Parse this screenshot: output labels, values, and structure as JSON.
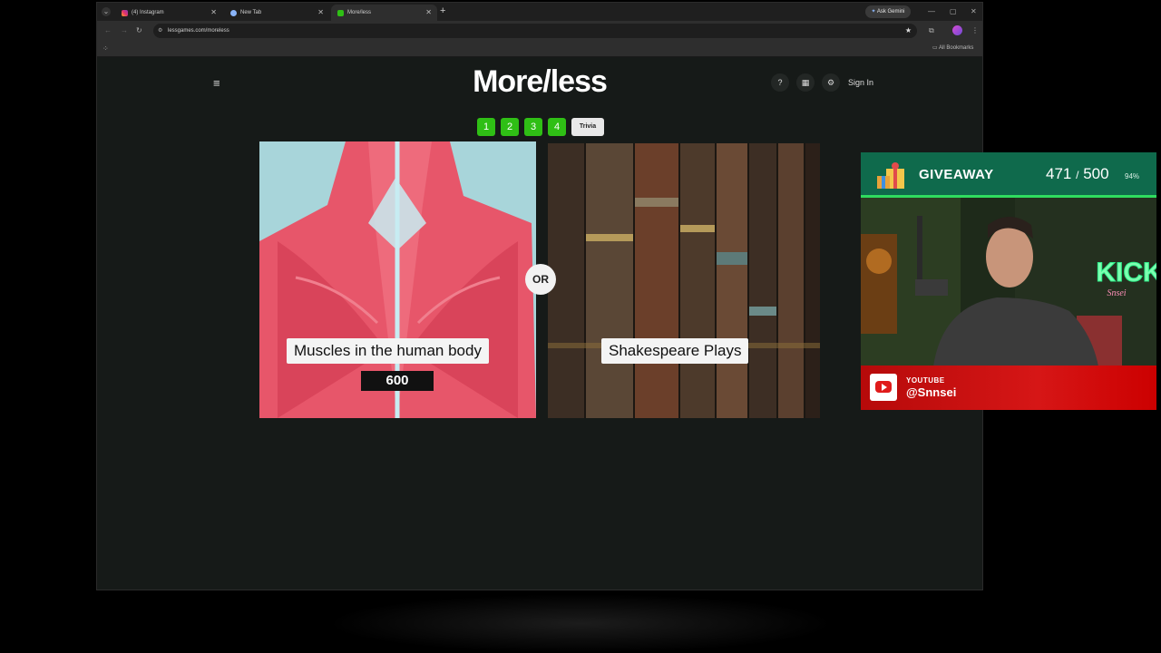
{
  "browser": {
    "tabs": [
      {
        "label": "(4) Instagram",
        "active": false
      },
      {
        "label": "New Tab",
        "active": false
      },
      {
        "label": "More/less",
        "active": true
      }
    ],
    "new_tab": "+",
    "ask_gemini": "Ask Gemini",
    "url": "lessgames.com/moreless",
    "bookmarks_label": "All Bookmarks"
  },
  "page": {
    "logo": "More/less",
    "help": "?",
    "sign_in": "Sign In",
    "levels": [
      "1",
      "2",
      "3",
      "4"
    ],
    "trivia": "Trivia",
    "or_label": "OR",
    "left_card": {
      "title": "Muscles in the human body",
      "value": "600"
    },
    "right_card": {
      "title": "Shakespeare Plays"
    }
  },
  "overlay": {
    "giveaway_label": "GIVEAWAY",
    "giveaway_current": "471",
    "giveaway_sep": "/",
    "giveaway_goal": "500",
    "giveaway_percent": "94%",
    "youtube_label": "YOUTUBE",
    "youtube_handle": "@Snnsei",
    "neon_sign": "KICK",
    "neon_sub": "Snsei"
  },
  "colors": {
    "level_green": "#2fbf15",
    "giveaway_bg": "#0f6a4c",
    "youtube_red": "#d61616",
    "page_bg": "#161a18"
  }
}
